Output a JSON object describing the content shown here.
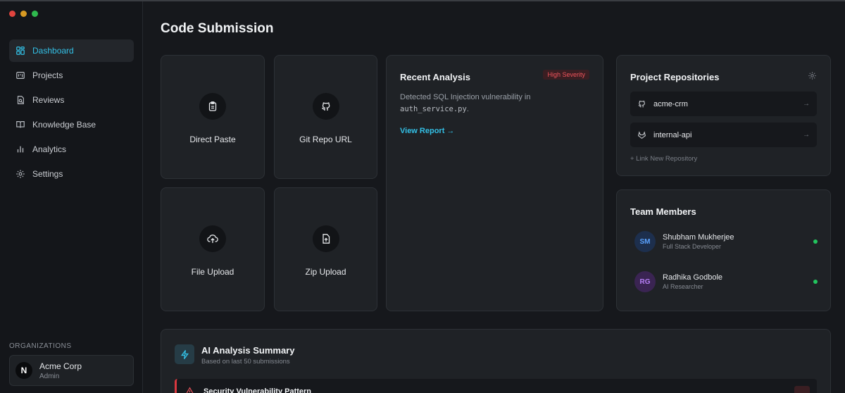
{
  "window": {
    "controls": [
      "close",
      "minimize",
      "maximize"
    ],
    "colors": [
      "#e0443e",
      "#d89a23",
      "#2fb94e"
    ]
  },
  "sidebar": {
    "items": [
      {
        "label": "Dashboard",
        "icon": "dashboard-icon",
        "active": true
      },
      {
        "label": "Projects",
        "icon": "folder-icon",
        "active": false
      },
      {
        "label": "Reviews",
        "icon": "review-icon",
        "active": false
      },
      {
        "label": "Knowledge Base",
        "icon": "book-icon",
        "active": false
      },
      {
        "label": "Analytics",
        "icon": "bar-chart-icon",
        "active": false
      },
      {
        "label": "Settings",
        "icon": "gear-icon",
        "active": false
      }
    ],
    "org_section_label": "ORGANIZATIONS",
    "org": {
      "logo": "N",
      "name": "Acme Corp",
      "role": "Admin"
    }
  },
  "main": {
    "title": "Code Submission",
    "tiles": [
      {
        "label": "Direct Paste",
        "icon": "clipboard-icon"
      },
      {
        "label": "Git Repo URL",
        "icon": "github-icon"
      },
      {
        "label": "File Upload",
        "icon": "cloud-upload-icon"
      },
      {
        "label": "Zip Upload",
        "icon": "file-upload-icon"
      }
    ],
    "recent_analysis": {
      "title": "Recent Analysis",
      "badge": "High Severity",
      "desc_prefix": "Detected SQL Injection vulnerability in",
      "file": "auth_service.py",
      "desc_suffix": ".",
      "link": "View Report →"
    },
    "repositories": {
      "title": "Project Repositories",
      "items": [
        {
          "name": "acme-crm",
          "icon": "github-icon"
        },
        {
          "name": "internal-api",
          "icon": "gitlab-icon"
        }
      ],
      "link_new": "+ Link New Repository"
    },
    "team": {
      "title": "Team Members",
      "members": [
        {
          "initials": "SM",
          "name": "Shubham Mukherjee",
          "role": "Full Stack Developer",
          "avatar_bg": "#1d2f4d",
          "avatar_fg": "#5aa2ff",
          "online": true
        },
        {
          "initials": "RG",
          "name": "Radhika Godbole",
          "role": "AI Researcher",
          "avatar_bg": "#3a2452",
          "avatar_fg": "#b57ef5",
          "online": true
        }
      ],
      "status_color": "#22c55e"
    },
    "summary": {
      "title": "AI Analysis Summary",
      "subtitle": "Based on last 50 submissions",
      "pattern_title": "Security Vulnerability Pattern"
    }
  },
  "colors": {
    "accent": "#33c0e6",
    "danger": "#f0545c",
    "background": "#16181c",
    "card": "#1f2226"
  }
}
